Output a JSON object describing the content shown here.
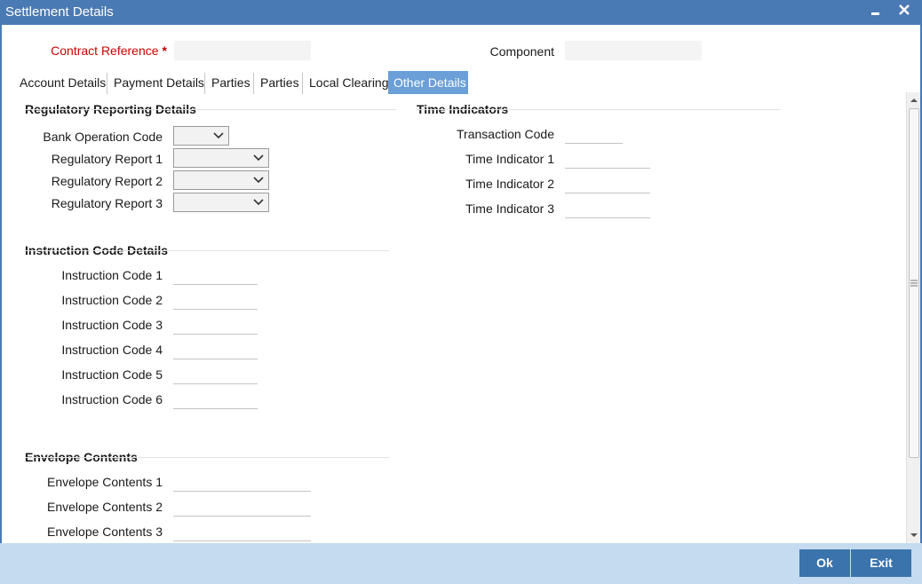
{
  "window": {
    "title": "Settlement Details",
    "minimize_glyph": "▬",
    "close_glyph": "✕"
  },
  "header": {
    "contract_reference_label": "Contract Reference",
    "required_mark": "*",
    "contract_reference_value": "",
    "component_label": "Component",
    "component_value": ""
  },
  "tabs": [
    {
      "label": "Account Details"
    },
    {
      "label": "Payment Details"
    },
    {
      "label": "Parties"
    },
    {
      "label": "Parties"
    },
    {
      "label": "Local Clearing"
    },
    {
      "label": "Other Details",
      "active": true
    }
  ],
  "regulatory": {
    "title": "Regulatory Reporting Details",
    "bank_operation_code_label": "Bank Operation Code",
    "bank_operation_code_value": "",
    "report1_label": "Regulatory Report 1",
    "report1_value": "",
    "report2_label": "Regulatory Report 2",
    "report2_value": "",
    "report3_label": "Regulatory Report 3",
    "report3_value": ""
  },
  "time_indicators": {
    "title": "Time Indicators",
    "transaction_code_label": "Transaction Code",
    "transaction_code_value": "",
    "ti1_label": "Time Indicator 1",
    "ti1_value": "",
    "ti2_label": "Time Indicator 2",
    "ti2_value": "",
    "ti3_label": "Time Indicator 3",
    "ti3_value": ""
  },
  "instruction": {
    "title": "Instruction Code Details",
    "ic1_label": "Instruction Code 1",
    "ic1_value": "",
    "ic2_label": "Instruction Code 2",
    "ic2_value": "",
    "ic3_label": "Instruction Code 3",
    "ic3_value": "",
    "ic4_label": "Instruction Code 4",
    "ic4_value": "",
    "ic5_label": "Instruction Code 5",
    "ic5_value": "",
    "ic6_label": "Instruction Code 6",
    "ic6_value": ""
  },
  "envelope": {
    "title": "Envelope Contents",
    "ec1_label": "Envelope Contents 1",
    "ec1_value": "",
    "ec2_label": "Envelope Contents 2",
    "ec2_value": "",
    "ec3_label": "Envelope Contents 3",
    "ec3_value": ""
  },
  "footer": {
    "ok_label": "Ok",
    "exit_label": "Exit"
  },
  "colors": {
    "titlebar": "#4a7ab3",
    "active_tab": "#6a9fd8",
    "footer": "#c5dbef",
    "button": "#3b73ad",
    "required": "#cc0000"
  },
  "icons": {
    "minimize": "minimize-icon",
    "close": "close-icon",
    "select_arrow": "chevron-down-icon"
  }
}
